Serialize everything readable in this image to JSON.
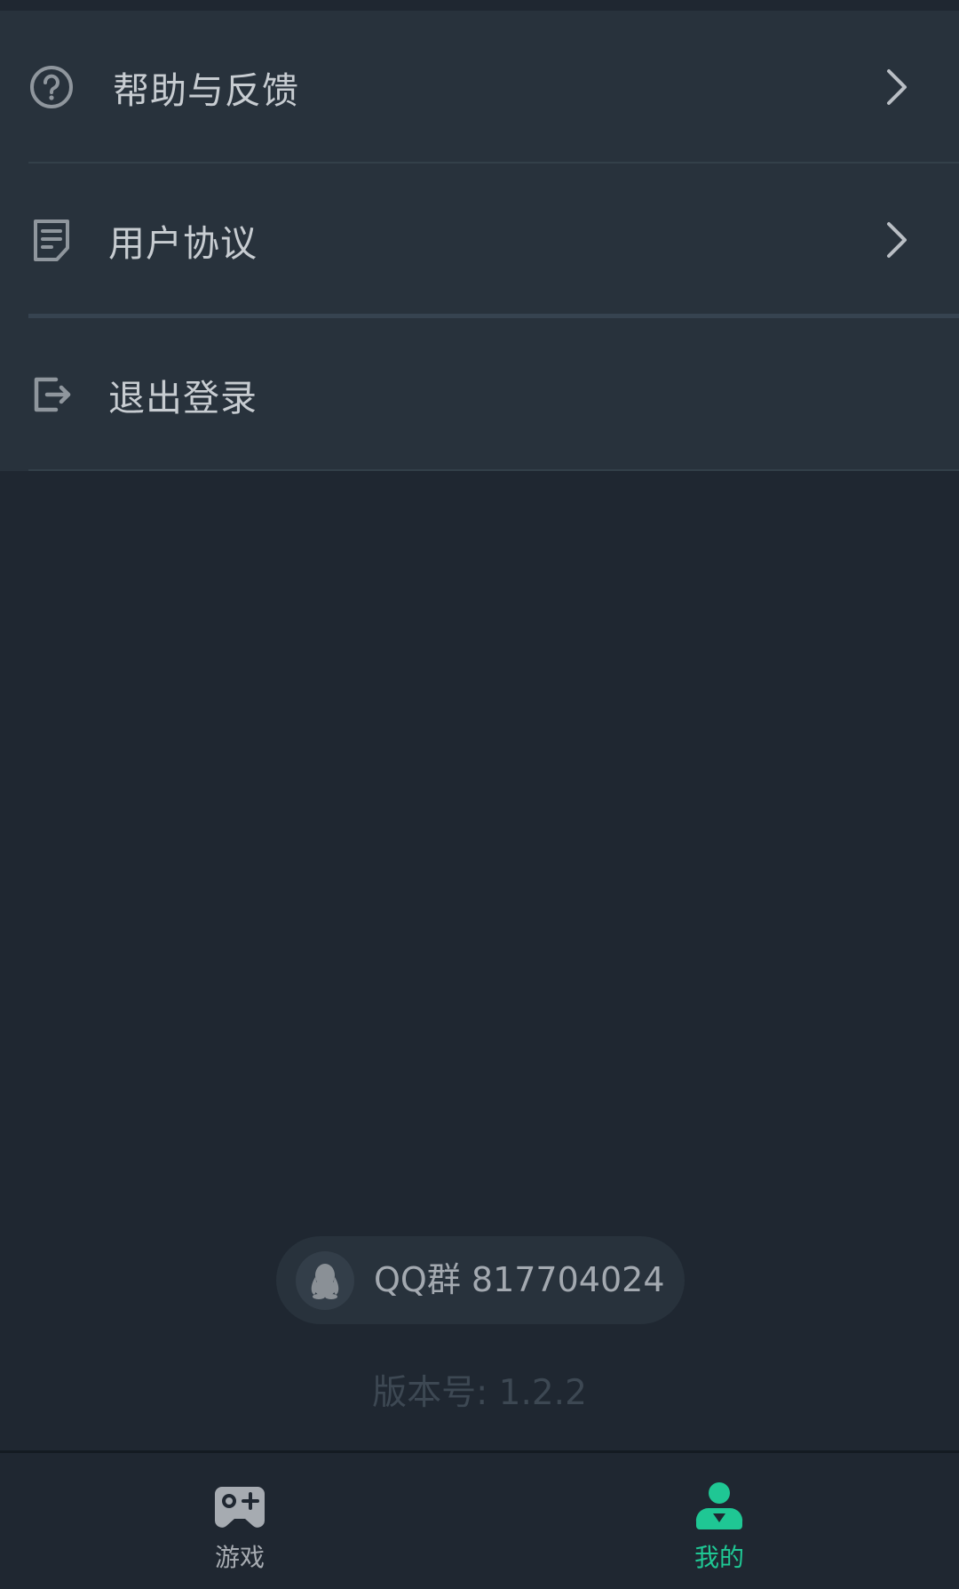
{
  "menu": {
    "items": [
      {
        "label": "帮助与反馈",
        "icon": "help-circle-icon",
        "has_chevron": true
      },
      {
        "label": "用户协议",
        "icon": "document-icon",
        "has_chevron": true
      },
      {
        "label": "退出登录",
        "icon": "logout-icon",
        "has_chevron": false
      }
    ]
  },
  "qq_group": {
    "text": "QQ群 817704024",
    "icon": "qq-penguin-icon"
  },
  "version": {
    "text": "版本号: 1.2.2"
  },
  "bottom_nav": {
    "tabs": [
      {
        "label": "游戏",
        "icon": "gamepad-icon",
        "active": false
      },
      {
        "label": "我的",
        "icon": "user-icon",
        "active": true
      }
    ]
  },
  "colors": {
    "background": "#1f2731",
    "card": "#28323c",
    "text": "#c7ccd1",
    "muted": "#a3a9b0",
    "accent": "#1fc794",
    "inactive_tab": "#a6abb1"
  }
}
